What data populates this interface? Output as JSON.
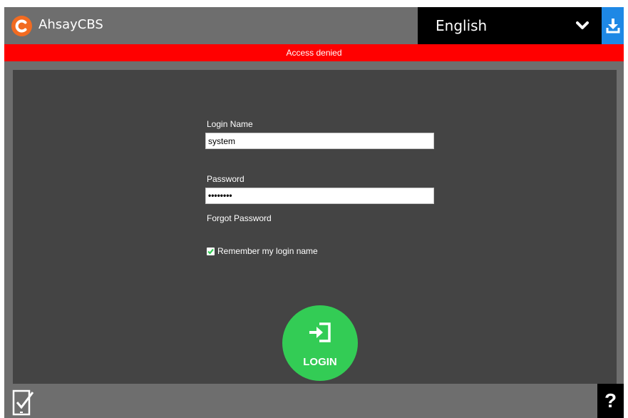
{
  "app": {
    "brand_name": "AhsayCBS",
    "brand_color": "#f26b21"
  },
  "header": {
    "language_selected": "English",
    "chevron_icon": "chevron-down-icon",
    "download_icon": "download-icon",
    "download_color": "#1e88e5"
  },
  "alert": {
    "message": "Access denied",
    "color": "#ff0000"
  },
  "form": {
    "login_name_label": "Login Name",
    "login_name_value": "system",
    "password_label": "Password",
    "password_value": "••••••••",
    "forgot_password": "Forgot Password",
    "remember_label": "Remember my login name",
    "remember_checked": true,
    "login_button_label": "LOGIN",
    "login_color": "#33cc55"
  },
  "footer": {
    "mobile_icon": "mobile-check-icon",
    "help_label": "?"
  }
}
